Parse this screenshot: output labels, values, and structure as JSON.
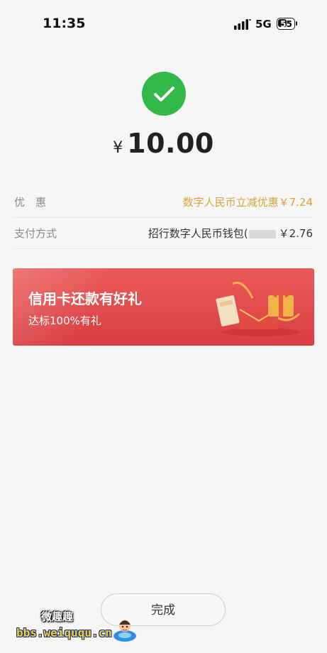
{
  "status_bar": {
    "time": "11:35",
    "network": "5G",
    "battery": "55",
    "icons": [
      "signal-icon",
      "battery-icon"
    ]
  },
  "payment": {
    "status_icon": "check-circle-icon",
    "currency": "¥",
    "amount": "10.00",
    "success_color": "#35b84a"
  },
  "details": [
    {
      "label": "优　惠",
      "value": "数字人民币立减优惠￥7.24",
      "accent": "#d8a43a"
    },
    {
      "label": "支付方式",
      "value_prefix": "招行数字人民币钱包(",
      "value_suffix": "￥2.76"
    }
  ],
  "banner": {
    "title": "信用卡还款有好礼",
    "subtitle": "达标100%有礼",
    "icon": "gift-box-icon",
    "color": "#dd4646"
  },
  "actions": {
    "done_label": "完成"
  },
  "watermark": {
    "logo_text": "微趣趣",
    "url": "bbs.weiququ.cn",
    "icon": "mascot-icon"
  }
}
